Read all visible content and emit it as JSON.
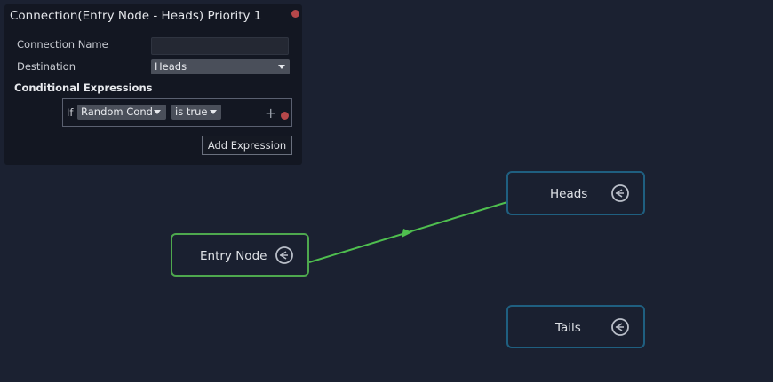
{
  "panel": {
    "title": "Connection(Entry Node - Heads) Priority 1",
    "connection_name_label": "Connection Name",
    "connection_name_value": "",
    "destination_label": "Destination",
    "destination_value": "Heads",
    "conditional_label": "Conditional Expressions",
    "expression": {
      "if_label": "If",
      "condition": "Random Cond",
      "operator": "is true",
      "add_icon": "plus-icon",
      "remove_icon": "remove-dot"
    },
    "add_expression_label": "Add Expression"
  },
  "graph": {
    "nodes": [
      {
        "id": "heads",
        "label": "Heads",
        "type": "state",
        "icon": "state-node-icon"
      },
      {
        "id": "entry",
        "label": "Entry Node",
        "type": "entry",
        "icon": "state-node-icon"
      },
      {
        "id": "tails",
        "label": "Tails",
        "type": "state",
        "icon": "state-node-icon"
      }
    ],
    "connections": [
      {
        "from": "Entry Node",
        "to": "Heads",
        "color": "#4fbf4f"
      }
    ]
  },
  "colors": {
    "background": "#1b2131",
    "panel": "#131722",
    "entry_border": "#4ea84e",
    "state_border": "#1f5f80",
    "close": "#b5474a"
  }
}
